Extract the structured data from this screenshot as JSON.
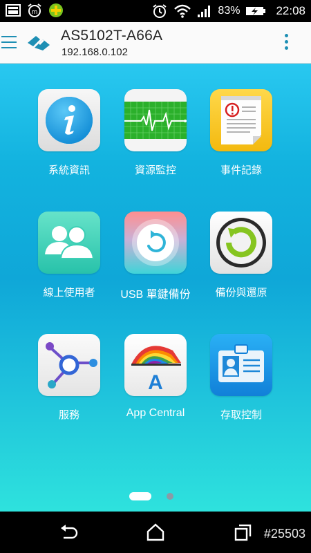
{
  "status_bar": {
    "battery": "83%",
    "time": "22:08",
    "icons": [
      "screenshot-icon",
      "alarm-clock-icon",
      "badge-app-icon",
      "alarm-icon",
      "wifi-icon",
      "signal-icon",
      "battery-charging-icon"
    ]
  },
  "app_bar": {
    "device_name": "AS5102T-A66A",
    "device_ip": "192.168.0.102",
    "menu_icon": "hamburger-menu-icon",
    "overflow_icon": "overflow-menu-icon",
    "accent": "#1e8fb4"
  },
  "grid": [
    {
      "label": "系統資訊",
      "icon": "info-icon"
    },
    {
      "label": "資源監控",
      "icon": "heartbeat-monitor-icon"
    },
    {
      "label": "事件記錄",
      "icon": "event-log-icon"
    },
    {
      "label": "線上使用者",
      "icon": "users-icon"
    },
    {
      "label": "USB 單鍵備份",
      "icon": "usb-backup-icon"
    },
    {
      "label": "備份與還原",
      "icon": "backup-restore-icon"
    },
    {
      "label": "服務",
      "icon": "services-network-icon"
    },
    {
      "label": "App Central",
      "icon": "app-central-icon"
    },
    {
      "label": "存取控制",
      "icon": "access-control-id-icon"
    }
  ],
  "pager": {
    "pages": 2,
    "current": 1
  },
  "nav_bar": {
    "icons": [
      "back-icon",
      "home-icon",
      "recents-icon"
    ],
    "watermark": "#25503"
  }
}
